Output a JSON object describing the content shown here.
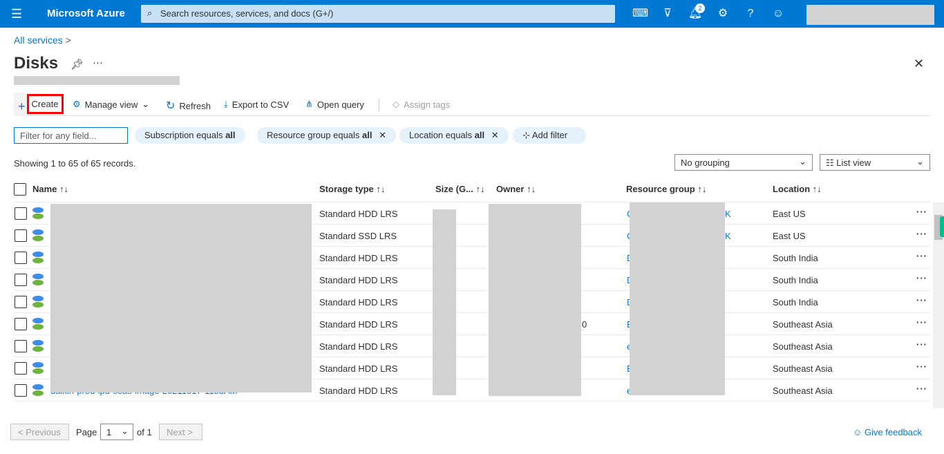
{
  "topbar": {
    "brand": "Microsoft Azure",
    "search_placeholder": "Search resources, services, and docs (G+/)",
    "notification_count": "2",
    "icons": [
      "cloud-shell-icon",
      "directory-filter-icon",
      "bell-icon",
      "gear-icon",
      "help-icon",
      "feedback-icon"
    ]
  },
  "breadcrumb": {
    "item": "All services",
    "sep": ">"
  },
  "page": {
    "title": "Disks",
    "more": "···",
    "close": "✕"
  },
  "toolbar": {
    "create": "Create",
    "manage_view": "Manage view",
    "refresh": "Refresh",
    "export": "Export to CSV",
    "open_query": "Open query",
    "assign_tags": "Assign tags"
  },
  "filters": {
    "placeholder": "Filter for any field...",
    "pills": [
      {
        "label": "Subscription equals ",
        "value": "all"
      },
      {
        "label": "Resource group equals ",
        "value": "all"
      },
      {
        "label": "Location equals ",
        "value": "all"
      }
    ],
    "add_filter": "Add filter"
  },
  "status": "Showing 1 to 65 of 65 records.",
  "grouping": "No grouping",
  "view": "List view",
  "columns": [
    "Name",
    "Storage type",
    "Size (G...",
    "Owner",
    "Resource group",
    "Location"
  ],
  "rows": [
    {
      "name": "",
      "storage": "Standard HDD LRS",
      "rg": "C",
      "rg_end": "K",
      "location": "East US"
    },
    {
      "name": "",
      "storage": "Standard SSD LRS",
      "rg": "C",
      "rg_end": "K",
      "location": "East US"
    },
    {
      "name": "",
      "storage": "Standard HDD LRS",
      "rg": "D",
      "rg_end": "",
      "location": "South India"
    },
    {
      "name": "",
      "storage": "Standard HDD LRS",
      "rg": "D",
      "rg_end": "",
      "location": "South India"
    },
    {
      "name": "",
      "storage": "Standard HDD LRS",
      "rg": "D",
      "rg_end": "",
      "location": "South India"
    },
    {
      "name": "",
      "storage": "Standard HDD LRS",
      "rg": "E",
      "rg_end": "",
      "owner_end": "0",
      "location": "Southeast Asia"
    },
    {
      "name": "",
      "storage": "Standard HDD LRS",
      "rg": "e",
      "rg_end": "",
      "location": "Southeast Asia"
    },
    {
      "name": "",
      "storage": "Standard HDD LRS",
      "rg": "E",
      "rg_end": "",
      "location": "Southeast Asia"
    },
    {
      "name": "daikin-prod-lpu-seas-image-20211017-1153AM",
      "storage": "Standard HDD LRS",
      "rg": "e",
      "rg_end": "",
      "location": "Southeast Asia"
    }
  ],
  "pager": {
    "previous": "< Previous",
    "page_label": "Page",
    "page": "1",
    "of": "of 1",
    "next": "Next >"
  },
  "feedback": "Give feedback"
}
